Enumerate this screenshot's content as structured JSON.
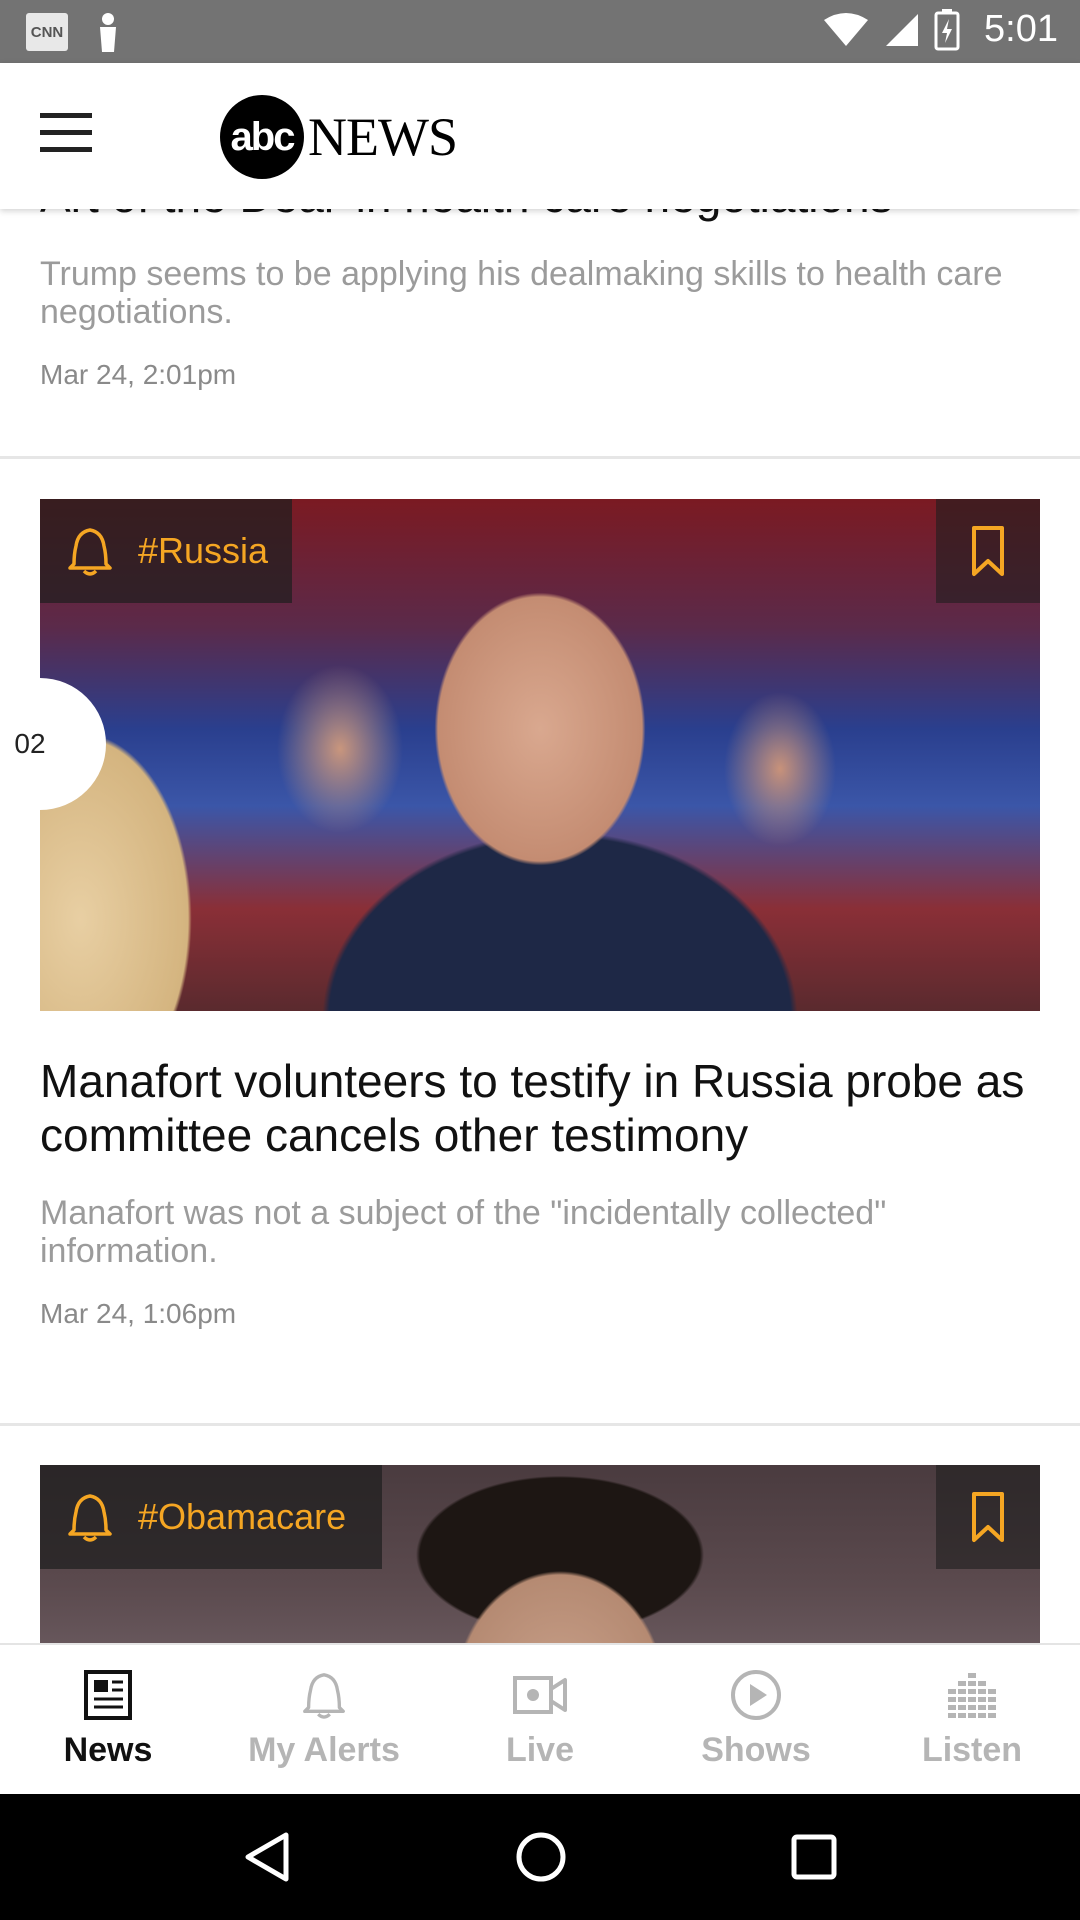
{
  "status_bar": {
    "notification_app": "CNN",
    "time": "5:01"
  },
  "header": {
    "logo_circle": "abc",
    "logo_text": "NEWS"
  },
  "stories": [
    {
      "title": "Art of the Deal' in health care negotiations",
      "summary": "Trump seems to be applying his dealmaking skills to health care negotiations.",
      "date": "Mar 24, 2:01pm"
    },
    {
      "rank": "02",
      "topic": "#Russia",
      "title": "Manafort volunteers to testify in Russia probe as committee cancels other testimony",
      "summary": "Manafort was not a subject of the \"incidentally collected\" information.",
      "date": "Mar 24, 1:06pm"
    },
    {
      "topic": "#Obamacare"
    }
  ],
  "bottom_nav": [
    {
      "label": "News",
      "icon": "newspaper-icon",
      "active": true
    },
    {
      "label": "My Alerts",
      "icon": "bell-icon",
      "active": false
    },
    {
      "label": "Live",
      "icon": "video-camera-icon",
      "active": false
    },
    {
      "label": "Shows",
      "icon": "play-circle-icon",
      "active": false
    },
    {
      "label": "Listen",
      "icon": "equalizer-icon",
      "active": false
    }
  ],
  "colors": {
    "accent": "#f5a623",
    "status_bar": "#737373",
    "inactive_nav": "#b5b5b5"
  }
}
